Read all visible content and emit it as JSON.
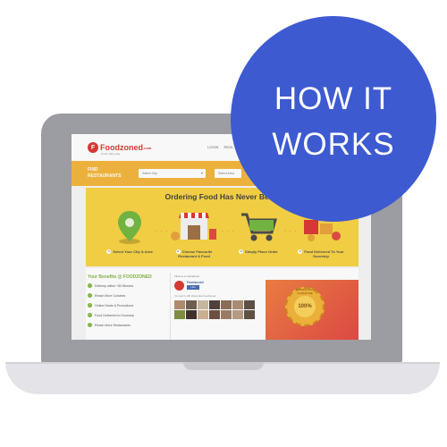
{
  "site": {
    "logo_letter": "F",
    "logo_text": "Foodzoned",
    "logo_domain": ".com",
    "logo_tagline": "smart spicy way",
    "top_links": [
      "LOGIN",
      "REGI..."
    ]
  },
  "search": {
    "find_label": "FIND RESTAURANTS",
    "city_placeholder": "Select City",
    "area_placeholder": "Select Area"
  },
  "hero": {
    "title": "Ordering Food Has Never Bee...",
    "steps": [
      {
        "num": "1",
        "label": "Select Your City & Area",
        "icon": "map-pin-icon"
      },
      {
        "num": "2",
        "label": "Choose Favourite Restaurant & Food",
        "icon": "restaurant-icon"
      },
      {
        "num": "3",
        "label": "Simply Place Order",
        "icon": "cart-icon"
      },
      {
        "num": "4",
        "label": "Food Delivered To Your Doorstep",
        "icon": "delivery-icon"
      }
    ]
  },
  "benefits": {
    "title": "Your Benefits @ FOODZONED",
    "items": [
      "Delivery within *45 Minutes",
      "Reach More Cuisines",
      "Online Deals & Promotions",
      "Food Delivered to Doorstep",
      "Reach More Restaurants"
    ]
  },
  "facebook": {
    "header": "Find us on Facebook",
    "page_name": "Foodzoned",
    "like_label": "Like",
    "sub_text": "You like this",
    "count_text": "You and 1,195 others like Foodzoned."
  },
  "seal": {
    "percent": "100%",
    "ring_text": "SATISFACTION GUARANTEE"
  },
  "badge": {
    "line1": "HOW IT",
    "line2": "WORKS"
  },
  "colors": {
    "brand_red": "#d9322b",
    "band_orange": "#f3b335",
    "hero_yellow": "#f7d13c",
    "badge_blue": "#3d5ad0",
    "benefit_green": "#7fb13a"
  }
}
